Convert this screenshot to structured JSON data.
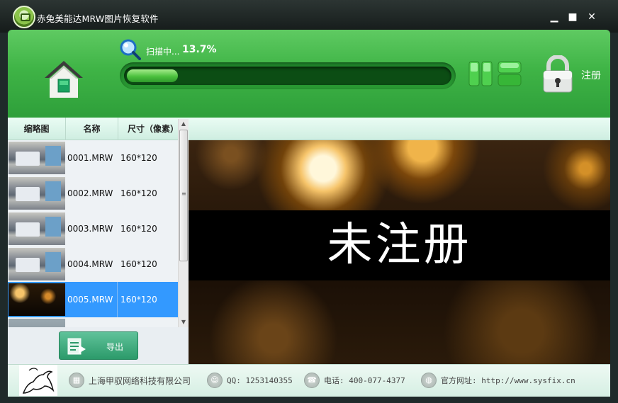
{
  "window": {
    "title": "赤兔美能达MRW图片恢复软件",
    "controls": {
      "minimize": "▁",
      "maximize": "■",
      "close": "✕"
    }
  },
  "header": {
    "scan_label": "扫描中...",
    "scan_percent": "13.7%",
    "progress_fraction": 0.137,
    "register_label": "注册",
    "icons": [
      "home-icon",
      "magnifier-icon",
      "list-view-icon",
      "grid-view-icon",
      "lock-icon"
    ]
  },
  "table": {
    "columns": [
      "缩略图",
      "名称",
      "尺寸（像素）"
    ],
    "rows": [
      {
        "name": "0001.MRW",
        "size": "160*120",
        "thumb": "office",
        "selected": false
      },
      {
        "name": "0002.MRW",
        "size": "160*120",
        "thumb": "office",
        "selected": false
      },
      {
        "name": "0003.MRW",
        "size": "160*120",
        "thumb": "office",
        "selected": false
      },
      {
        "name": "0004.MRW",
        "size": "160*120",
        "thumb": "office",
        "selected": false
      },
      {
        "name": "0005.MRW",
        "size": "160*120",
        "thumb": "night",
        "selected": true
      }
    ]
  },
  "export_label": "导出",
  "preview": {
    "watermark": "未注册"
  },
  "footer": {
    "company": "上海甲驭网络科技有限公司",
    "qq": "QQ: 1253140355",
    "phone": "电话: 400-077-4377",
    "website": "官方网址: http://www.sysfix.cn"
  },
  "colors": {
    "header_green": "#3fb446",
    "selected_row": "#3399ff",
    "titlebar": "#1b2221"
  }
}
